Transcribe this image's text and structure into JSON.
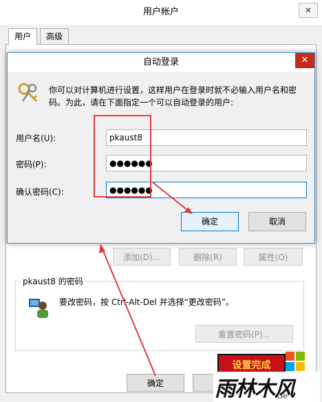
{
  "back_window": {
    "title": "用户帐户",
    "close": "✕",
    "tabs": [
      "用户",
      "高级"
    ],
    "buttons": {
      "add": "添加(D)...",
      "remove": "删除(R)",
      "properties": "属性(O)"
    },
    "password_group_title": "pkaust8 的密码",
    "password_hint": "要改密码，按 Ctrl-Alt-Del 并选择“更改密码”。",
    "reset_password": "重置密码(P)...",
    "ok": "确定"
  },
  "dialog": {
    "title": "自动登录",
    "close": "✕",
    "description": "你可以对计算机进行设置，这样用户在登录时就不必输入用户名和密码。为此，请在下面指定一个可以自动登录的用户:",
    "username_label": "用户名(U):",
    "username_value": "pkaust8",
    "password_label": "密码(P):",
    "password_value": "●●●●●●",
    "confirm_label": "确认密码(C):",
    "confirm_value": "●●●●●●",
    "ok": "确定",
    "cancel": "取消"
  },
  "watermark": {
    "stamp": "设置完成",
    "logo_text": "雨林木风",
    "logo_sub": "YLMF"
  },
  "colors": {
    "annotation_red": "#e03a3a",
    "accent_blue": "#0078d7",
    "close_red": "#c42b1c"
  }
}
